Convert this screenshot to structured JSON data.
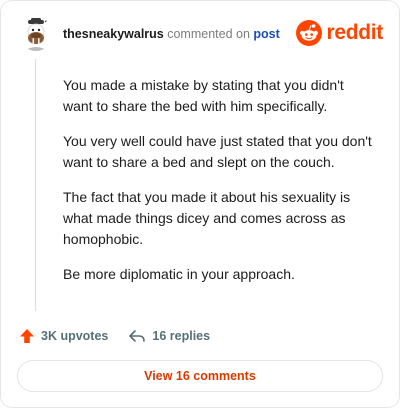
{
  "comment": {
    "username": "thesneakywalrus",
    "commented_on": "commented on",
    "post_link": "post",
    "paragraphs": [
      "You made a mistake by stating that you didn't want to share the bed with him specifically.",
      "You very well could have just stated that you don't want to share a bed and slept on the couch.",
      "The fact that you made it about his sexuality is what made things dicey and comes across as homophobic.",
      "Be more diplomatic in your approach."
    ]
  },
  "brand": {
    "name": "reddit",
    "icon": "reddit-snoo-icon",
    "color": "#ff4500"
  },
  "actions": {
    "upvotes": "3K upvotes",
    "replies": "16 replies",
    "upvote_icon": "upvote-arrow-icon",
    "reply_icon": "reply-arrow-icon",
    "upvote_color": "#ff4500"
  },
  "view_comments": {
    "label": "View 16 comments",
    "color": "#d93a00"
  }
}
